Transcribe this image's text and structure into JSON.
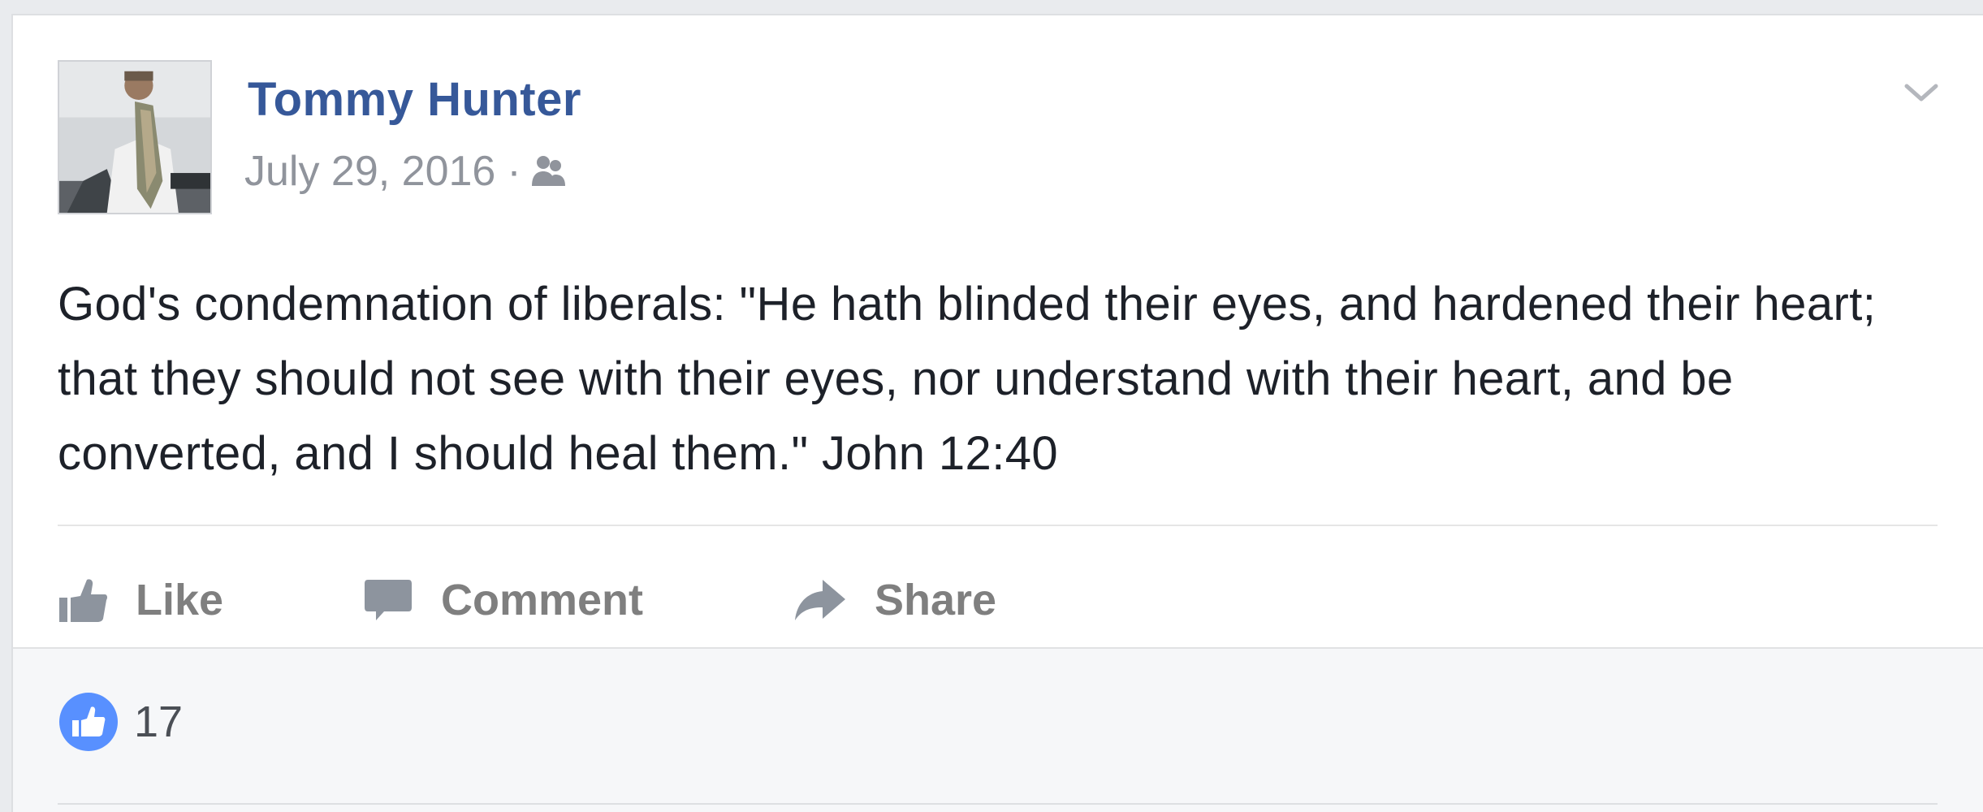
{
  "post": {
    "author": "Tommy Hunter",
    "date": "July 29, 2016",
    "separator": "·",
    "audience_icon": "friends-icon",
    "menu_icon": "chevron-down-icon",
    "text": "God's condemnation of liberals: \"He hath blinded their eyes, and hardened their heart; that they should not see with their eyes, nor understand with their heart, and be converted, and I should heal them.\" John 12:40"
  },
  "actions": {
    "like_label": "Like",
    "comment_label": "Comment",
    "share_label": "Share"
  },
  "reactions": {
    "icon": "like-reaction-icon",
    "count": "17"
  },
  "colors": {
    "author_link": "#365899",
    "meta_text": "#90949c",
    "action_text": "#7f7f7f",
    "like_blue": "#5890ff"
  }
}
